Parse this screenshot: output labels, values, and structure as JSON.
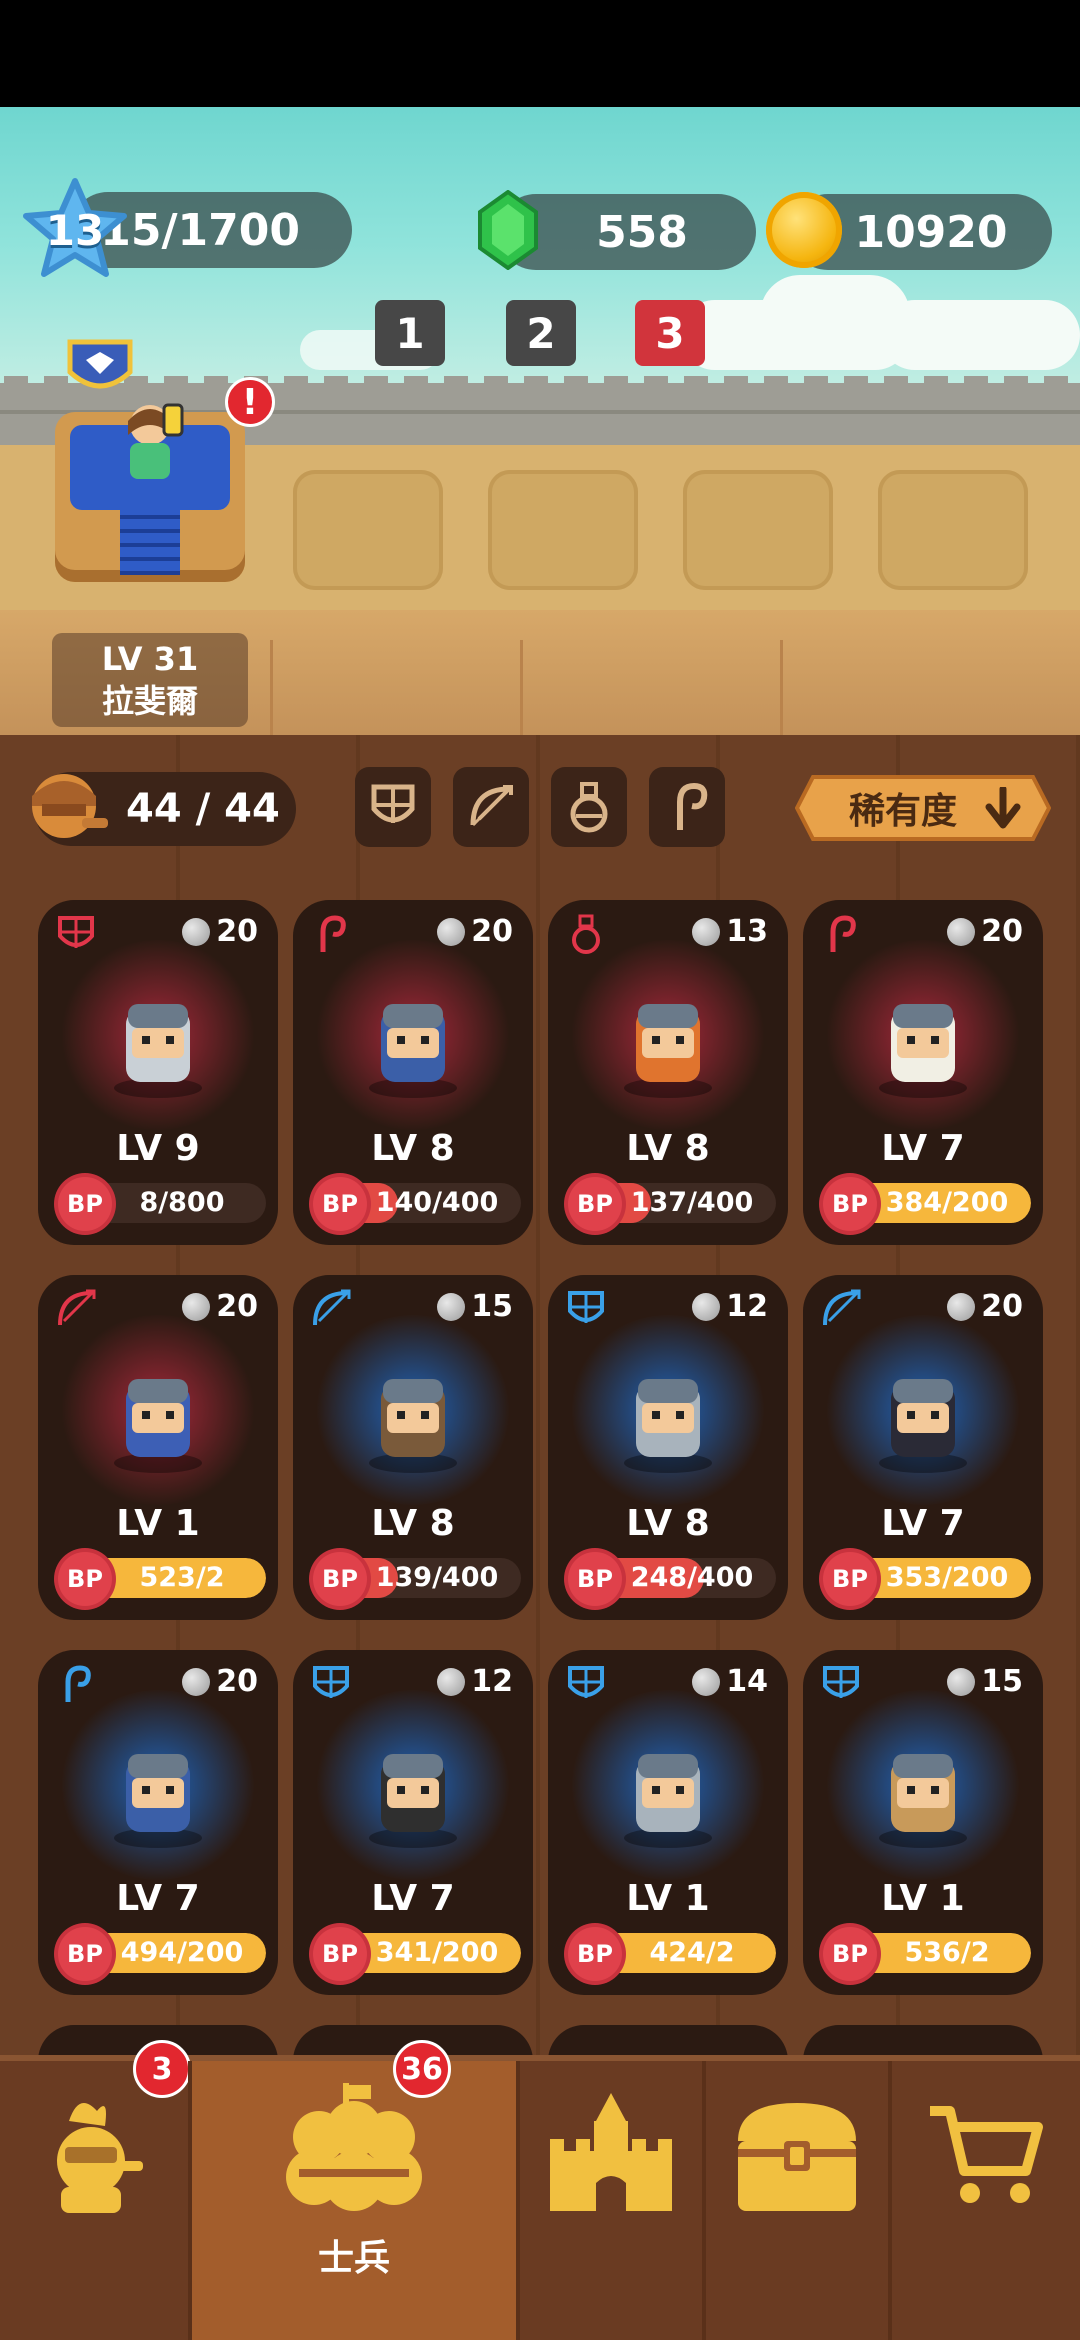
{
  "hud": {
    "level": "13",
    "xp": "15/1700",
    "gems": "558",
    "coins": "10920"
  },
  "waves": [
    {
      "label": "1",
      "active": false
    },
    {
      "label": "2",
      "active": false
    },
    {
      "label": "3",
      "active": true
    }
  ],
  "hero": {
    "level_label": "LV 31",
    "name": "拉斐爾",
    "alert": "!"
  },
  "troops": {
    "count": "44 / 44",
    "sort_label": "稀有度"
  },
  "cards": [
    {
      "type": "shield",
      "type_color": "#e2364a",
      "cost": "20",
      "level": "LV 9",
      "bp": "8/800",
      "bp_progress": 0.01,
      "glow": "#a4283a",
      "unit": "knight-lancer"
    },
    {
      "type": "staff",
      "type_color": "#e2364a",
      "cost": "20",
      "level": "LV 8",
      "bp": "140/400",
      "bp_progress": 0.35,
      "glow": "#a4283a",
      "unit": "thunder-mage"
    },
    {
      "type": "potion",
      "type_color": "#e2364a",
      "cost": "13",
      "level": "LV 8",
      "bp": "137/400",
      "bp_progress": 0.34,
      "glow": "#a4283a",
      "unit": "alchemist"
    },
    {
      "type": "staff",
      "type_color": "#e2364a",
      "cost": "20",
      "level": "LV 7",
      "bp": "384/200",
      "bp_progress": 1.0,
      "glow": "#a4283a",
      "unit": "priest"
    },
    {
      "type": "bow",
      "type_color": "#e2364a",
      "cost": "20",
      "level": "LV 1",
      "bp": "523/2",
      "bp_progress": 1.0,
      "glow": "#a4283a",
      "unit": "axe-thrower"
    },
    {
      "type": "bow",
      "type_color": "#3aa0e8",
      "cost": "15",
      "level": "LV 8",
      "bp": "139/400",
      "bp_progress": 0.35,
      "glow": "#1f63b8",
      "unit": "falconer"
    },
    {
      "type": "shield",
      "type_color": "#3aa0e8",
      "cost": "12",
      "level": "LV 8",
      "bp": "248/400",
      "bp_progress": 0.62,
      "glow": "#1f63b8",
      "unit": "shield-knight"
    },
    {
      "type": "bow",
      "type_color": "#3aa0e8",
      "cost": "20",
      "level": "LV 7",
      "bp": "353/200",
      "bp_progress": 1.0,
      "glow": "#1f63b8",
      "unit": "cannoneer"
    },
    {
      "type": "staff",
      "type_color": "#3aa0e8",
      "cost": "20",
      "level": "LV 7",
      "bp": "494/200",
      "bp_progress": 1.0,
      "glow": "#1f63b8",
      "unit": "fire-mage"
    },
    {
      "type": "shield",
      "type_color": "#3aa0e8",
      "cost": "12",
      "level": "LV 7",
      "bp": "341/200",
      "bp_progress": 1.0,
      "glow": "#1f63b8",
      "unit": "bandit"
    },
    {
      "type": "shield",
      "type_color": "#3aa0e8",
      "cost": "14",
      "level": "LV 1",
      "bp": "424/2",
      "bp_progress": 1.0,
      "glow": "#1f63b8",
      "unit": "iron-knight"
    },
    {
      "type": "shield",
      "type_color": "#3aa0e8",
      "cost": "15",
      "level": "LV 1",
      "bp": "536/2",
      "bp_progress": 1.0,
      "glow": "#1f63b8",
      "unit": "barrel-brute"
    }
  ],
  "nav": {
    "hero_badge": "3",
    "soldiers_badge": "36",
    "soldiers_label": "士兵"
  },
  "colors": {
    "bp_fill": "#f6b73c",
    "bp_fill_partial": "#e24a44",
    "wave_active": "#d1343c",
    "wave_inactive": "#474747"
  }
}
